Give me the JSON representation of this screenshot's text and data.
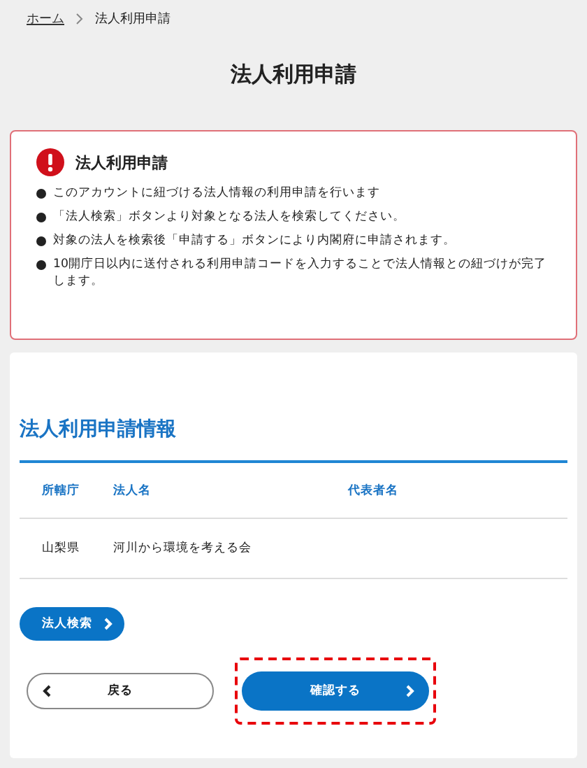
{
  "breadcrumb": [
    {
      "label": "ホーム",
      "link": true
    },
    {
      "label": "法人利用申請",
      "link": false
    }
  ],
  "page_title": "法人利用申請",
  "notice": {
    "title": "法人利用申請",
    "items": [
      "このアカウントに紐づける法人情報の利用申請を行います",
      "「法人検索」ボタンより対象となる法人を検索してください。",
      "対象の法人を検索後「申請する」ボタンにより内閣府に申請されます。",
      "10開庁日以内に送付される利用申請コードを入力することで法人情報との紐づけが完了します。"
    ]
  },
  "section_title": "法人利用申請情報",
  "table": {
    "columns": [
      "所轄庁",
      "法人名",
      "代表者名"
    ],
    "rows": [
      {
        "cells": [
          "山梨県",
          "河川から環境を考える会"
        ]
      }
    ]
  },
  "search_button": "法人検索",
  "buttons": [
    {
      "label": "戻る",
      "kind": "back",
      "highlighted": false
    },
    {
      "label": "確認する",
      "kind": "primary",
      "highlighted": true
    }
  ]
}
